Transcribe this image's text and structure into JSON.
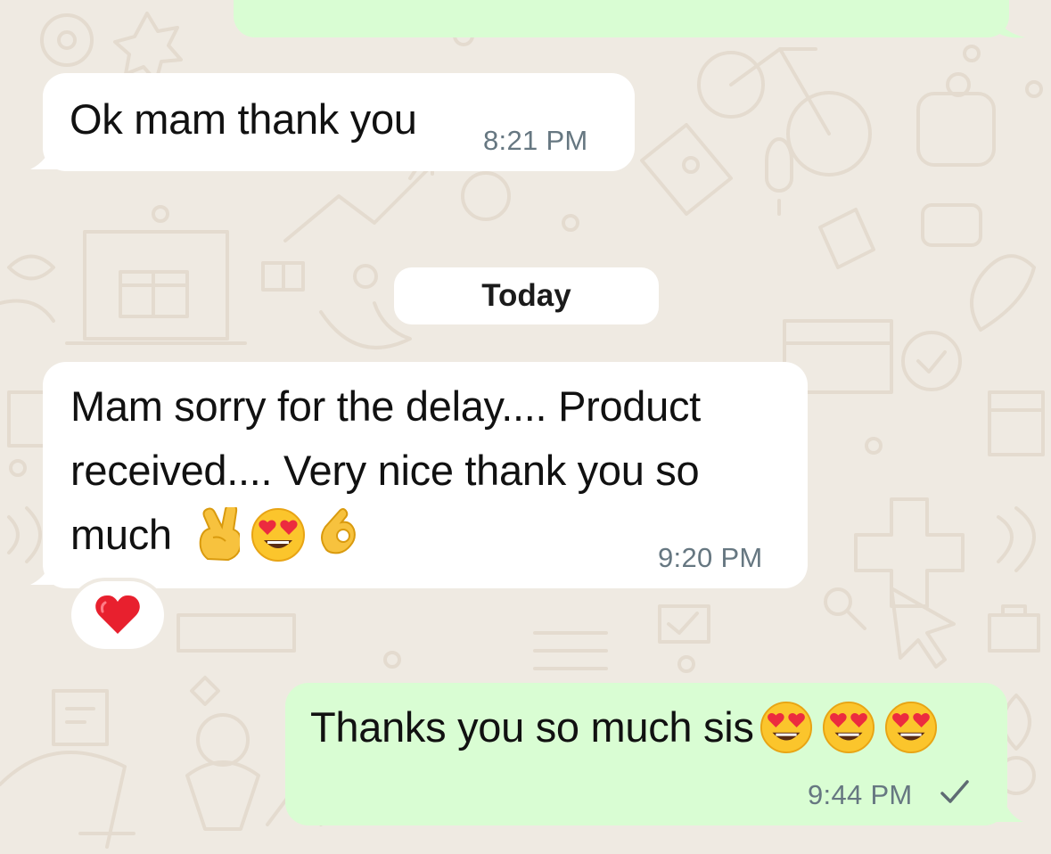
{
  "date_divider": "Today",
  "messages": [
    {
      "direction": "in",
      "text": "Ok mam thank you",
      "time": "8:21 PM"
    },
    {
      "direction": "in",
      "text_lines": [
        "Mam sorry for the delay.... Product",
        "received.... Very nice thank you so",
        "much"
      ],
      "emojis": [
        "crossed-fingers",
        "heart-eyes",
        "ok-hand"
      ],
      "time": "9:20 PM",
      "reaction": "red-heart"
    },
    {
      "direction": "out",
      "text": "Thanks you so much sis",
      "emojis": [
        "heart-eyes",
        "heart-eyes",
        "heart-eyes"
      ],
      "time": "9:44 PM",
      "status": "sent-single-check"
    }
  ],
  "colors": {
    "background": "#efeae2",
    "incoming_bubble": "#ffffff",
    "outgoing_bubble": "#d9fdd3",
    "timestamp": "#667781",
    "text": "#111111"
  }
}
